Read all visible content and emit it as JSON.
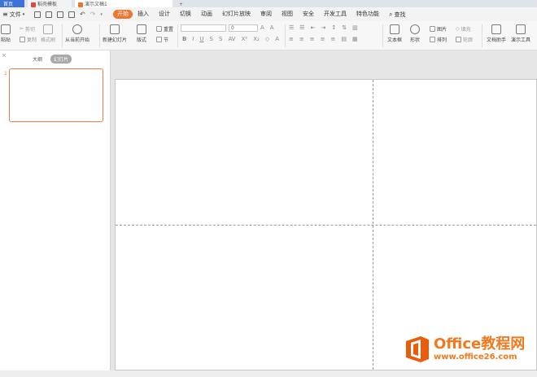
{
  "tabs": [
    {
      "label": "首页"
    },
    {
      "label": "稻壳模板"
    },
    {
      "label": "演示文稿1"
    },
    {
      "label": "+"
    }
  ],
  "menubar": {
    "file_label": "文件",
    "menus": [
      "开始",
      "插入",
      "设计",
      "切换",
      "动画",
      "幻灯片放映",
      "审阅",
      "视图",
      "安全",
      "开发工具",
      "特色功能"
    ],
    "search_label": "查找"
  },
  "ribbon": {
    "paste": "粘贴",
    "cut": "剪切",
    "copy": "复制",
    "format_painter": "格式刷",
    "from_current": "从当前开始",
    "new_slide": "新建幻灯片",
    "layout": "版式",
    "reset": "重置",
    "section": "节",
    "font_size_value": "0",
    "textbox": "文本框",
    "shape": "形状",
    "picture": "图片",
    "arrange": "排列",
    "fill": "填充",
    "outline": "轮廓",
    "doc_assistant": "文档助手",
    "present_tools": "演示工具"
  },
  "left_panel": {
    "tab_outline": "大纲",
    "tab_slides": "幻灯片",
    "slide_number": "1"
  },
  "watermark": {
    "title": "Office教程网",
    "url": "www.office26.com"
  }
}
